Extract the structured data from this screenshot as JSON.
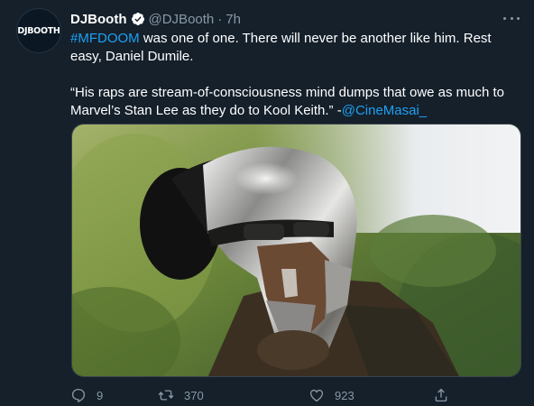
{
  "author": {
    "avatar_text": "DJBOOTH",
    "name": "DJBooth",
    "handle": "@DJBooth",
    "separator": "·",
    "time": "7h"
  },
  "tweet": {
    "hashtag": "#MFDOOM",
    "line1_rest": " was one of one. There will never be another like him. Rest easy, Daniel Dumile.",
    "quote": "“His raps are stream-of-consciousness mind dumps that owe as much to Marvel’s Stan Lee as they do to Kool Keith.” -",
    "mention": "@CineMasai_"
  },
  "actions": {
    "reply_count": "9",
    "retweet_count": "370",
    "like_count": "923"
  },
  "colors": {
    "background": "#15202b",
    "link": "#1da1f2",
    "muted": "#8899a6"
  },
  "icons": [
    "verified-badge-icon",
    "more-options-icon",
    "reply-icon",
    "retweet-icon",
    "like-icon",
    "share-icon"
  ]
}
